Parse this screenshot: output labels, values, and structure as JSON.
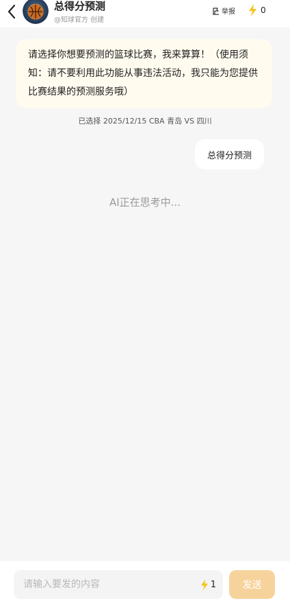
{
  "header": {
    "title": "总得分预测",
    "subtitle": "@知球官方 创建",
    "report_label": "举报",
    "energy_count": "0"
  },
  "chat": {
    "bot_message": "请选择你想要预测的篮球比赛，我来算算！（使用须知：请不要利用此功能从事违法活动，我只能为您提供比赛结果的预测服务哦）",
    "system_note": "已选择 2025/12/15 CBA 青岛 VS 四川",
    "user_message": "总得分预测",
    "thinking": "AI正在思考中..."
  },
  "composer": {
    "placeholder": "请输入要发的内容",
    "cost": "1",
    "send_label": "发送"
  },
  "colors": {
    "accent": "#f5c518",
    "bot_bubble": "#fffbef",
    "send_button": "#f7d39c"
  }
}
